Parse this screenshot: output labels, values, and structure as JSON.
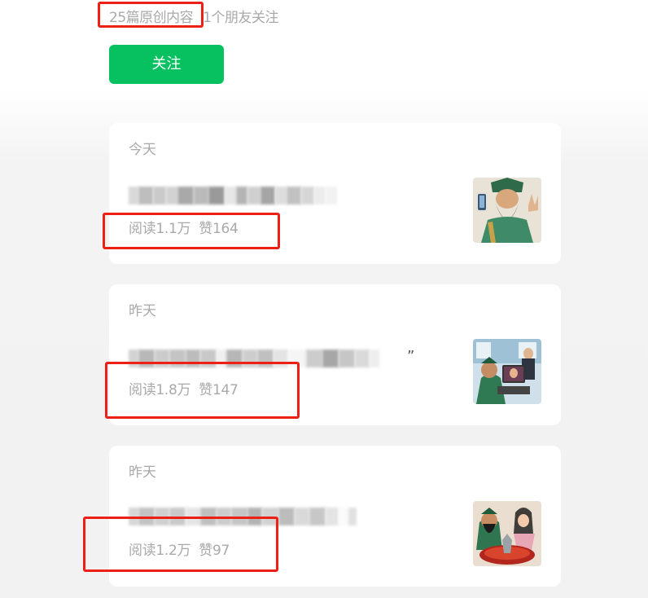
{
  "header": {
    "original_count": "25篇原创内容",
    "friends_following": "1个朋友关注"
  },
  "follow_button": {
    "label": "关注"
  },
  "articles": [
    {
      "date": "今天",
      "reads_label": "阅读",
      "reads": "1.1万",
      "likes_label": "赞",
      "likes": "164",
      "title_trailing": ""
    },
    {
      "date": "昨天",
      "reads_label": "阅读",
      "reads": "1.8万",
      "likes_label": "赞",
      "likes": "147",
      "title_trailing": "”"
    },
    {
      "date": "昨天",
      "reads_label": "阅读",
      "reads": "1.2万",
      "likes_label": "赞",
      "likes": "97",
      "title_trailing": ""
    }
  ],
  "colors": {
    "accent_green": "#07c160",
    "highlight_red": "#ee1f14",
    "muted_text": "#a9a9a9"
  },
  "icons": [
    "thumbnail-guan-yu-selfie",
    "thumbnail-guan-yu-office",
    "thumbnail-guan-yu-hotpot"
  ]
}
